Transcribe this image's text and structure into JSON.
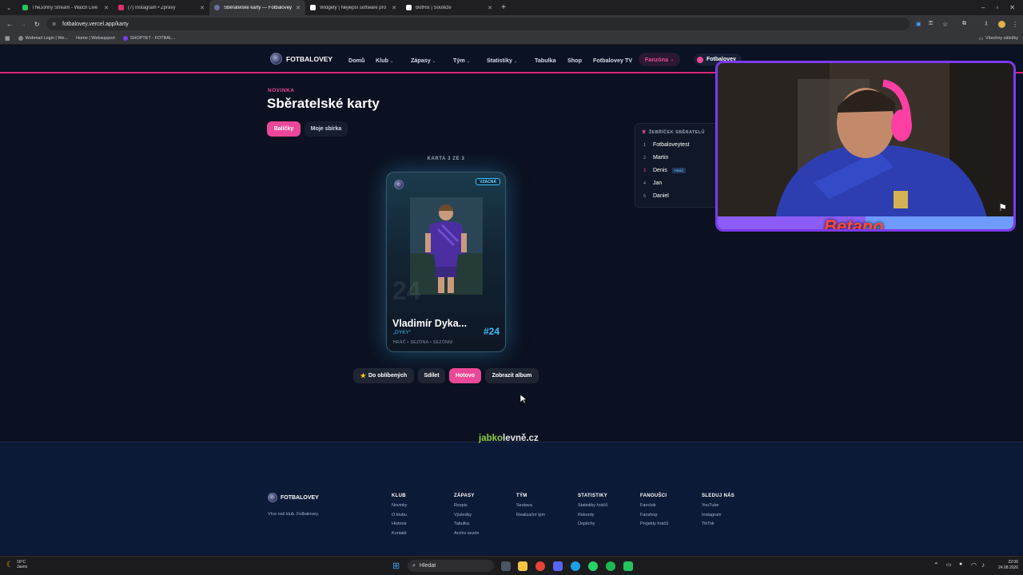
{
  "browser": {
    "tabs": [
      {
        "label": "TheJohny Stream - Watch Live",
        "color": "#22c55e"
      },
      {
        "label": "(7) Instagram • Zprávy",
        "color": "#e1306c"
      },
      {
        "label": "Sběratelské karty — Fotbalovey",
        "color": "#6b6fa0"
      },
      {
        "label": "Widgety | Nejlepší software pro",
        "color": "#ffffff"
      },
      {
        "label": "BotRix | Soutěže",
        "color": "#ffffff"
      }
    ],
    "url": "fotbalovey.vercel.app/karty",
    "bookmarks": [
      "Webmail Login | We...",
      "Home | Websupport",
      "SHOPTET - FOTBAL..."
    ],
    "all_bookmarks": "Všechny záložky"
  },
  "nav": {
    "brand": "FOTBALOVEY",
    "items": [
      "Domů",
      "Klub",
      "Zápasy",
      "Tým",
      "Statistiky",
      "Tabulka",
      "Shop",
      "Fotbalovey TV",
      "Fanzóna"
    ],
    "user": "Fotbalovey"
  },
  "page": {
    "kicker": "NOVINKA",
    "title": "Sběratelské karty",
    "tab_packs": "Balíčky",
    "tab_collection": "Moje sbírka",
    "card_counter": "KARTA 3 ZE 3"
  },
  "card": {
    "rarity": "VZÁCNÁ",
    "name": "Vladimír Dyka...",
    "nickname": "„DYKY“",
    "number": "#24",
    "bg_number": "24",
    "meta": "HRÁČ • SEZÓNA • SEZÓNNÍ"
  },
  "actions": {
    "favorite": "Do oblíbených",
    "share": "Sdílet",
    "done": "Hotovo",
    "album": "Zobrazit album"
  },
  "leaderboard": {
    "title": "ŽEBŘÍČEK SBĚRATELŮ",
    "rows": [
      {
        "rank": "1",
        "name": "Fotbaloveytest",
        "badge": ""
      },
      {
        "rank": "2",
        "name": "Martin",
        "badge": ""
      },
      {
        "rank": "3",
        "name": "Denis",
        "badge": "HRÁČ"
      },
      {
        "rank": "4",
        "name": "Jan",
        "badge": ""
      },
      {
        "rank": "5",
        "name": "Daniel",
        "badge": ""
      }
    ]
  },
  "sponsor": {
    "left": "jabko",
    "right": "levně.cz"
  },
  "stream_overlay": {
    "sponsor": "Betano"
  },
  "footer": {
    "brand": "FOTBALOVEY",
    "tagline": "Více než klub. Fotbalovey.",
    "columns": [
      {
        "title": "KLUB",
        "links": [
          "Novinky",
          "O klubu",
          "Historie",
          "Kontakt"
        ]
      },
      {
        "title": "ZÁPASY",
        "links": [
          "Rozpis",
          "Výsledky",
          "Tabulka",
          "Archiv sezón"
        ]
      },
      {
        "title": "TÝM",
        "links": [
          "Sestava",
          "Realizační tým"
        ]
      },
      {
        "title": "STATISTIKY",
        "links": [
          "Statistiky hráčů",
          "Rekordy",
          "Úspěchy"
        ]
      },
      {
        "title": "FANOUŠCI",
        "links": [
          "Fanclub",
          "Fanshop",
          "Projekty hráčů"
        ]
      },
      {
        "title": "SLEDUJ NÁS",
        "links": [
          "YouTube",
          "Instagram",
          "TikTok"
        ]
      }
    ]
  },
  "taskbar": {
    "weather_temp": "16°C",
    "weather_desc": "Jasno",
    "search": "Hledat",
    "time": "22:06",
    "date": "24.08.2026"
  },
  "colors": {
    "accent": "#ec4899",
    "card_glow": "#38bdf8",
    "number": "#38bdf8"
  }
}
